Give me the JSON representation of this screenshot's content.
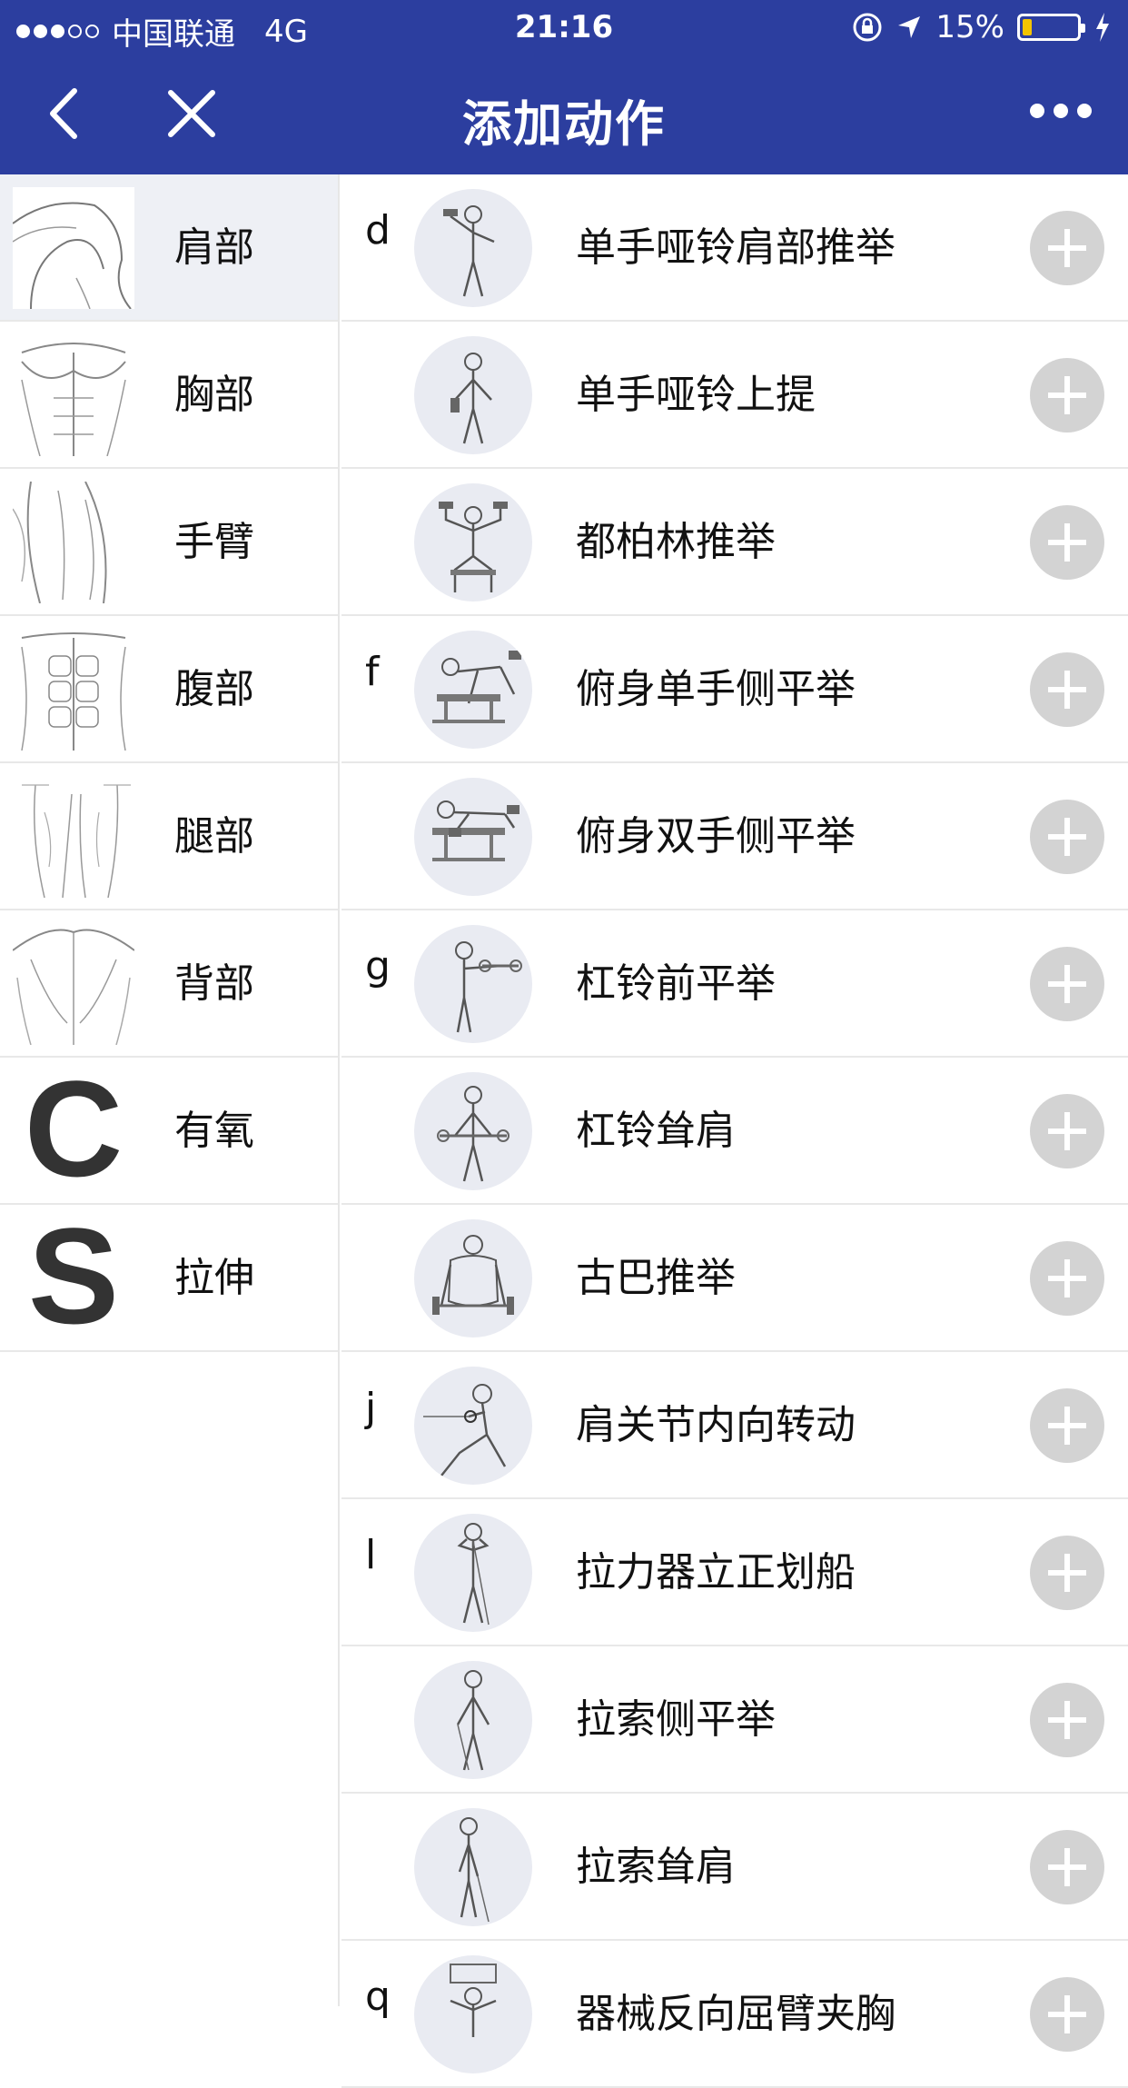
{
  "status_bar": {
    "carrier": "中国联通",
    "network": "4G",
    "time": "21:16",
    "battery": "15%",
    "signal_bars": 3,
    "signal_total": 5,
    "battery_level": 0.15
  },
  "nav": {
    "title": "添加动作",
    "back_icon": "chevron-left-icon",
    "close_icon": "close-icon",
    "more_icon": "ellipsis-icon"
  },
  "categories": [
    {
      "label": "肩部",
      "selected": true
    },
    {
      "label": "胸部",
      "selected": false
    },
    {
      "label": "手臂",
      "selected": false
    },
    {
      "label": "腹部",
      "selected": false
    },
    {
      "label": "腿部",
      "selected": false
    },
    {
      "label": "背部",
      "selected": false
    },
    {
      "label": "有氧",
      "icon_letter": "C",
      "selected": false
    },
    {
      "label": "拉伸",
      "icon_letter": "S",
      "selected": false
    }
  ],
  "exercises": [
    {
      "index": "d",
      "name": "单手哑铃肩部推举"
    },
    {
      "index": "",
      "name": "单手哑铃上提"
    },
    {
      "index": "",
      "name": "都柏林推举"
    },
    {
      "index": "f",
      "name": "俯身单手侧平举"
    },
    {
      "index": "",
      "name": "俯身双手侧平举"
    },
    {
      "index": "g",
      "name": "杠铃前平举"
    },
    {
      "index": "",
      "name": "杠铃耸肩"
    },
    {
      "index": "",
      "name": "古巴推举"
    },
    {
      "index": "j",
      "name": "肩关节内向转动"
    },
    {
      "index": "l",
      "name": "拉力器立正划船"
    },
    {
      "index": "",
      "name": "拉索侧平举"
    },
    {
      "index": "",
      "name": "拉索耸肩"
    },
    {
      "index": "q",
      "name": "器械反向屈臂夹胸"
    }
  ],
  "colors": {
    "accent": "#2c3e9f",
    "selected_bg": "#eef0f5",
    "add_button": "#d3d3d3",
    "avatar_bg": "#e9ebf2",
    "battery_fill": "#f3c400"
  }
}
